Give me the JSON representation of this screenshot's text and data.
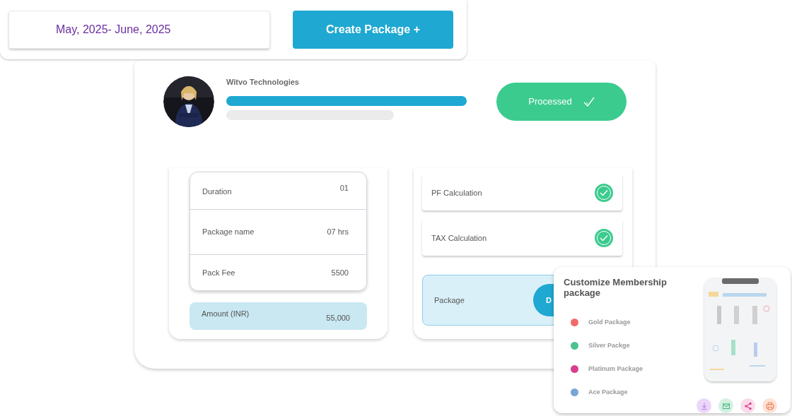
{
  "filter": {
    "date_range": "May, 2025- June, 2025",
    "create_button": "Create Package +"
  },
  "profile": {
    "company": "Witvo Technologies",
    "status": "Processed"
  },
  "details": [
    {
      "label": "Duration",
      "value": "01"
    },
    {
      "label": "Package name",
      "value": "07 hrs"
    },
    {
      "label": "Pack Fee",
      "value": "5500"
    }
  ],
  "amount": {
    "label": "Amount (INR)",
    "value": "55,000"
  },
  "calculations": [
    {
      "label": "PF Calculation",
      "checked": true
    },
    {
      "label": "TAX Calculation",
      "checked": true
    }
  ],
  "package": {
    "label": "Package",
    "button": "D"
  },
  "membership": {
    "title": "Customize Membership package",
    "items": [
      {
        "label": "Gold Package",
        "color": "#f26b6b"
      },
      {
        "label": "Silver Packge",
        "color": "#4cc28f"
      },
      {
        "label": "Platinum Package",
        "color": "#d63f8c"
      },
      {
        "label": "Ace Package",
        "color": "#78a6d6"
      }
    ],
    "actions": [
      {
        "kind": "download"
      },
      {
        "kind": "mail"
      },
      {
        "kind": "share"
      },
      {
        "kind": "print"
      }
    ]
  }
}
